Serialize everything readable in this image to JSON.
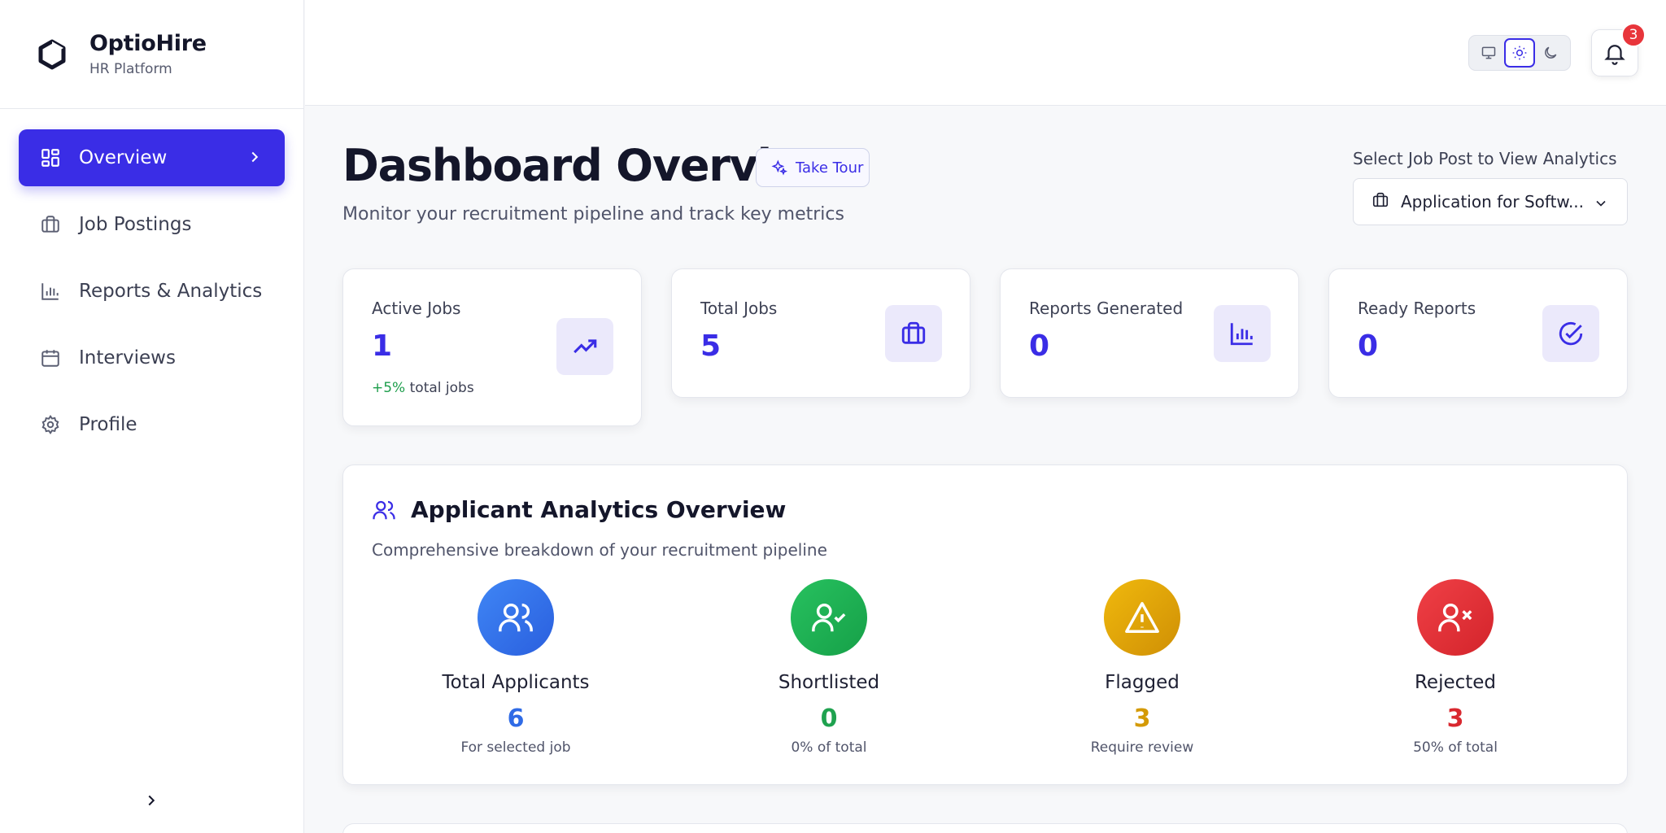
{
  "brand": {
    "name": "OptioHire",
    "subtitle": "HR Platform"
  },
  "sidebar": {
    "items": [
      {
        "label": "Overview",
        "icon": "layout-grid-icon",
        "active": true
      },
      {
        "label": "Job Postings",
        "icon": "briefcase-icon"
      },
      {
        "label": "Reports & Analytics",
        "icon": "bar-chart-icon"
      },
      {
        "label": "Interviews",
        "icon": "calendar-icon"
      },
      {
        "label": "Profile",
        "icon": "gear-icon"
      }
    ]
  },
  "topbar": {
    "theme_options": [
      "monitor-icon",
      "sun-icon",
      "moon-icon"
    ],
    "active_theme": "sun-icon",
    "notification_count": "3"
  },
  "header": {
    "title": "Dashboard Overview",
    "tour_label": "Take Tour",
    "subtitle": "Monitor your recruitment pipeline and track key metrics",
    "select_label": "Select Job Post to View Analytics",
    "selected_job": "Application for Softw..."
  },
  "stats": [
    {
      "label": "Active Jobs",
      "value": "1",
      "trend_pos": "+5%",
      "trend_rest": " total jobs",
      "icon": "trending-up-icon"
    },
    {
      "label": "Total Jobs",
      "value": "5",
      "icon": "briefcase-icon"
    },
    {
      "label": "Reports Generated",
      "value": "0",
      "icon": "bar-chart-icon"
    },
    {
      "label": "Ready Reports",
      "value": "0",
      "icon": "check-circle-icon"
    }
  ],
  "analytics": {
    "title": "Applicant Analytics Overview",
    "subtitle": "Comprehensive breakdown of your recruitment pipeline",
    "metrics": [
      {
        "name": "Total Applicants",
        "value": "6",
        "note": "For selected job",
        "color": "#2f6be6"
      },
      {
        "name": "Shortlisted",
        "value": "0",
        "note": "0% of total",
        "color": "#1fa24f"
      },
      {
        "name": "Flagged",
        "value": "3",
        "note": "Require review",
        "color": "#d49a06"
      },
      {
        "name": "Rejected",
        "value": "3",
        "note": "50% of total",
        "color": "#d9282f"
      }
    ]
  },
  "colors": {
    "accent": "#3a2de6",
    "positive": "#1e9e4c",
    "danger": "#e8353b"
  }
}
